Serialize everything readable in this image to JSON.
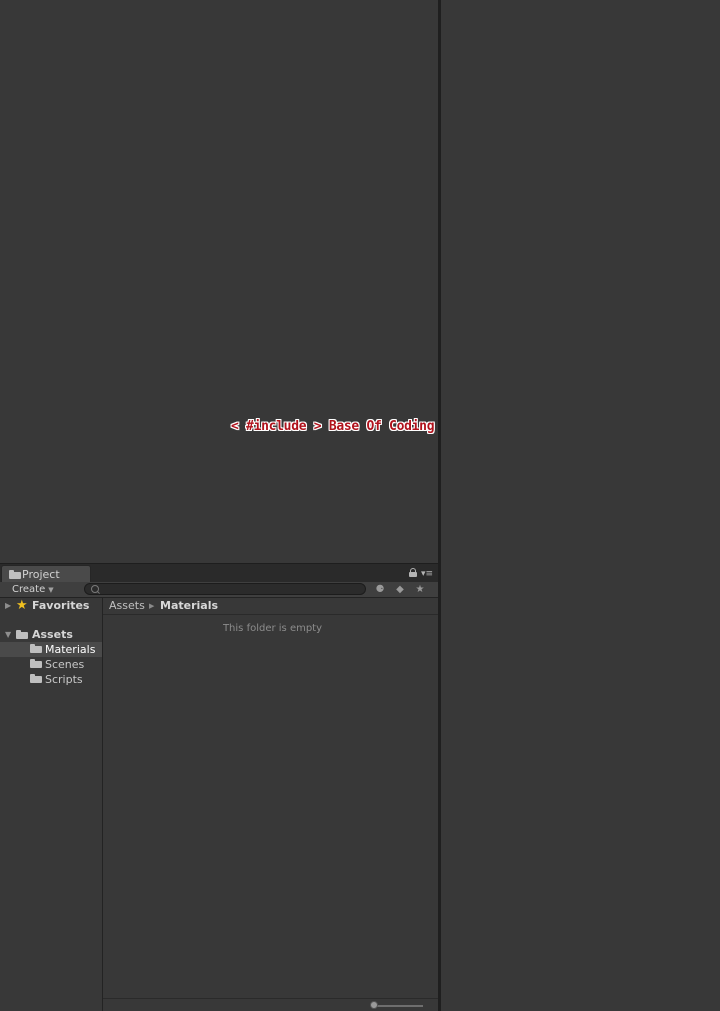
{
  "scene": {
    "watermark": "< #include > Base Of Coding"
  },
  "project": {
    "tab_label": "Project",
    "toolbar": {
      "create_label": "Create",
      "search_placeholder": ""
    },
    "sidebar": {
      "favorites_label": "Favorites",
      "assets_label": "Assets",
      "folders": [
        "Materials",
        "Scenes",
        "Scripts"
      ],
      "selected": "Materials"
    },
    "breadcrumb": {
      "root": "Assets",
      "current": "Materials"
    },
    "empty_message": "This folder is empty",
    "icon_size_slider": 0.0
  },
  "colors": {
    "background": "#383838",
    "divider": "#1f1f1f",
    "watermark_text": "#b0121c",
    "favorites_star": "#f0c020"
  }
}
